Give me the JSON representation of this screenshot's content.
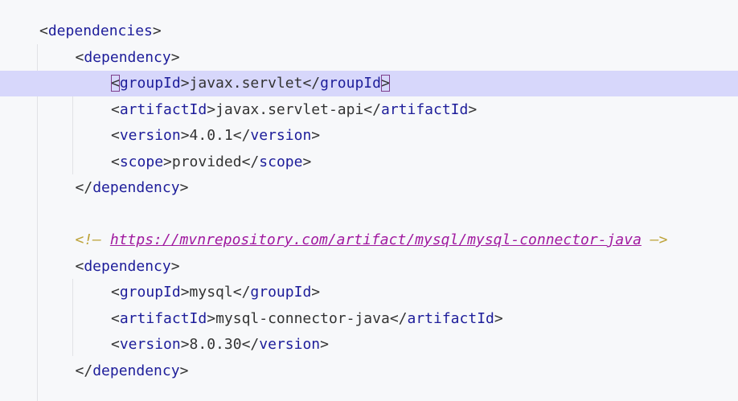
{
  "code_lines": [
    {
      "indent": 0,
      "parts": [
        [
          "b",
          "<"
        ],
        [
          "t",
          "dependencies"
        ],
        [
          "b",
          ">"
        ]
      ]
    },
    {
      "indent": 1,
      "parts": [
        [
          "b",
          "<"
        ],
        [
          "t",
          "dependency"
        ],
        [
          "b",
          ">"
        ]
      ]
    },
    {
      "indent": 2,
      "highlight": true,
      "parts": [
        [
          "b",
          "<",
          "match"
        ],
        [
          "t",
          "groupId"
        ],
        [
          "b",
          ">"
        ],
        [
          "v",
          "javax.servlet"
        ],
        [
          "b",
          "</"
        ],
        [
          "t",
          "groupId"
        ],
        [
          "b",
          ">",
          "match"
        ]
      ]
    },
    {
      "indent": 2,
      "parts": [
        [
          "b",
          "<"
        ],
        [
          "t",
          "artifactId"
        ],
        [
          "b",
          ">"
        ],
        [
          "v",
          "javax.servlet-api"
        ],
        [
          "b",
          "</"
        ],
        [
          "t",
          "artifactId"
        ],
        [
          "b",
          ">"
        ]
      ]
    },
    {
      "indent": 2,
      "parts": [
        [
          "b",
          "<"
        ],
        [
          "t",
          "version"
        ],
        [
          "b",
          ">"
        ],
        [
          "v",
          "4.0.1"
        ],
        [
          "b",
          "</"
        ],
        [
          "t",
          "version"
        ],
        [
          "b",
          ">"
        ]
      ]
    },
    {
      "indent": 2,
      "parts": [
        [
          "b",
          "<"
        ],
        [
          "t",
          "scope"
        ],
        [
          "b",
          ">"
        ],
        [
          "v",
          "provided"
        ],
        [
          "b",
          "</"
        ],
        [
          "t",
          "scope"
        ],
        [
          "b",
          ">"
        ]
      ]
    },
    {
      "indent": 1,
      "parts": [
        [
          "b",
          "</"
        ],
        [
          "t",
          "dependency"
        ],
        [
          "b",
          ">"
        ]
      ]
    },
    {
      "indent": 0,
      "parts": []
    },
    {
      "indent": 1,
      "parts": [
        [
          "c",
          "<!— "
        ],
        [
          "u",
          "https://mvnrepository.com/artifact/mysql/mysql-connector-java"
        ],
        [
          "c",
          " —>"
        ]
      ]
    },
    {
      "indent": 1,
      "parts": [
        [
          "b",
          "<"
        ],
        [
          "t",
          "dependency"
        ],
        [
          "b",
          ">"
        ]
      ]
    },
    {
      "indent": 2,
      "parts": [
        [
          "b",
          "<"
        ],
        [
          "t",
          "groupId"
        ],
        [
          "b",
          ">"
        ],
        [
          "v",
          "mysql"
        ],
        [
          "b",
          "</"
        ],
        [
          "t",
          "groupId"
        ],
        [
          "b",
          ">"
        ]
      ]
    },
    {
      "indent": 2,
      "parts": [
        [
          "b",
          "<"
        ],
        [
          "t",
          "artifactId"
        ],
        [
          "b",
          ">"
        ],
        [
          "v",
          "mysql-connector-java"
        ],
        [
          "b",
          "</"
        ],
        [
          "t",
          "artifactId"
        ],
        [
          "b",
          ">"
        ]
      ]
    },
    {
      "indent": 2,
      "parts": [
        [
          "b",
          "<"
        ],
        [
          "t",
          "version"
        ],
        [
          "b",
          ">"
        ],
        [
          "v",
          "8.0.30"
        ],
        [
          "b",
          "</"
        ],
        [
          "t",
          "version"
        ],
        [
          "b",
          ">"
        ]
      ]
    },
    {
      "indent": 1,
      "parts": [
        [
          "b",
          "</"
        ],
        [
          "t",
          "dependency"
        ],
        [
          "b",
          ">"
        ]
      ]
    }
  ],
  "colors": {
    "background": "#f7f8fa",
    "caret_line": "#d7d7fb",
    "tag_name": "#1d1d9a",
    "bracket": "#333333",
    "comment": "#bda237",
    "link": "#a0199f",
    "brace_match": "#7d3e8c"
  }
}
